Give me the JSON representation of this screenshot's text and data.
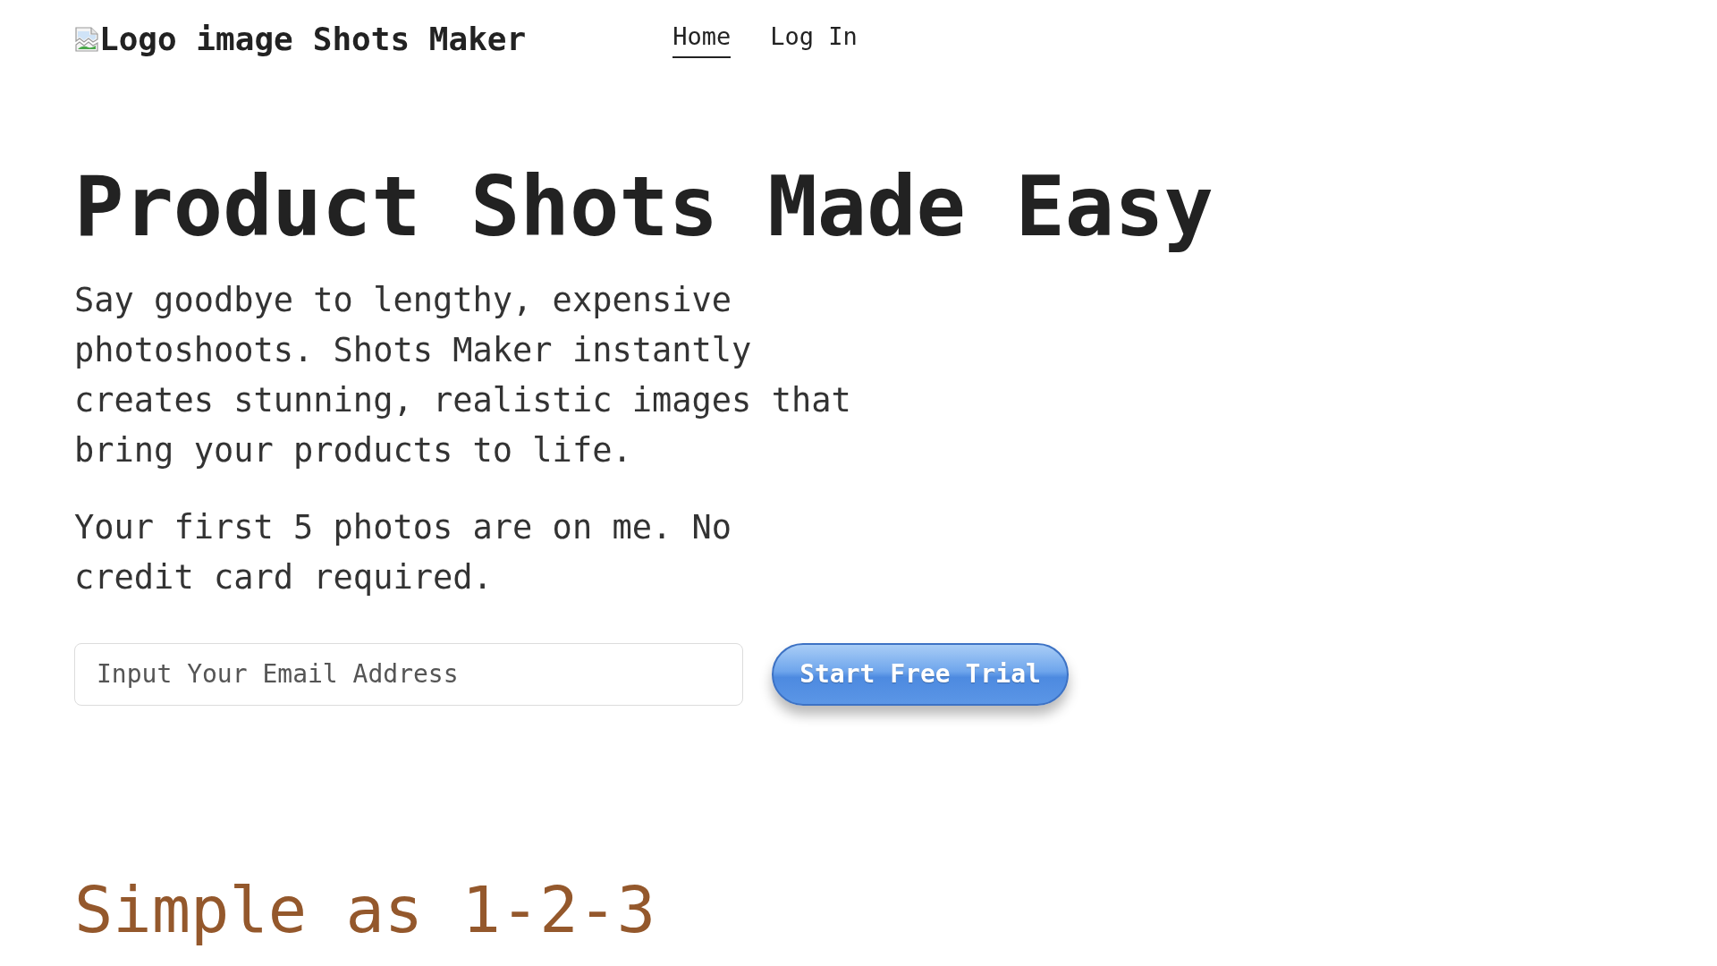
{
  "header": {
    "logo": {
      "image_alt": "Logo image",
      "name": "Shots Maker"
    },
    "nav": [
      {
        "label": "Home",
        "selected": true
      },
      {
        "label": "Log In",
        "selected": false
      }
    ]
  },
  "hero": {
    "title": "Product Shots Made Easy",
    "paragraphs": [
      "Say goodbye to lengthy, expensive photoshoots. Shots Maker instantly creates stunning, realistic images that bring your products to life.",
      "Your first 5 photos are on me. No credit card required."
    ],
    "signup": {
      "email_field": {
        "placeholder": "Input Your Email Address"
      },
      "button": "Start Free Trial"
    }
  },
  "section": {
    "title": "Simple as 1-2-3"
  }
}
